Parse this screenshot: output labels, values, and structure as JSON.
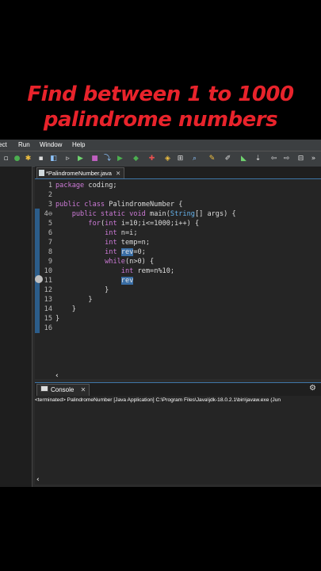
{
  "overlay": {
    "line1": "Find between 1 to 1000",
    "line2": "palindrome  numbers",
    "color": "#e8232b"
  },
  "menubar": {
    "items": [
      "ect",
      "Run",
      "Window",
      "Help"
    ]
  },
  "editor": {
    "tab_label": "*PalindromeNumber.java",
    "tab_close": "✕",
    "lines": [
      {
        "n": "1",
        "html": "<span class=\"kw\">package</span> coding;"
      },
      {
        "n": "2",
        "html": ""
      },
      {
        "n": "3",
        "html": "<span class=\"kw\">public class</span> PalindromeNumber {"
      },
      {
        "n": "4⊖",
        "html": "    <span class=\"kw\">public static void</span> main(<span class=\"ty\">String</span>[] args) {"
      },
      {
        "n": "5",
        "html": "        <span class=\"kw\">for</span>(<span class=\"kw\">int</span> i=10;i&lt;=1000;i++) {"
      },
      {
        "n": "6",
        "html": "            <span class=\"kw\">int</span> n=i;"
      },
      {
        "n": "7",
        "html": "            <span class=\"kw\">int</span> temp=n;"
      },
      {
        "n": "8",
        "html": "            <span class=\"kw\">int</span> <span class=\"hl\">rev</span>=0;"
      },
      {
        "n": "9",
        "html": "            <span class=\"kw\">while</span>(n&gt;0) {"
      },
      {
        "n": "10",
        "html": "                <span class=\"kw\">int</span> rem=n%10;"
      },
      {
        "n": "11",
        "html": "                <span class=\"hl\">rev</span>"
      },
      {
        "n": "12",
        "html": "            }"
      },
      {
        "n": "13",
        "html": "        }"
      },
      {
        "n": "14",
        "html": "    }"
      },
      {
        "n": "15",
        "html": "}"
      },
      {
        "n": "16",
        "html": ""
      }
    ]
  },
  "console": {
    "tab_label": "Console",
    "tab_close": "✕",
    "header": "<terminated> PalindromeNumber [Java Application] C:\\Program Files\\Java\\jdk-18.0.2.1\\bin\\javaw.exe  (Jun"
  },
  "scroll_left": "‹"
}
